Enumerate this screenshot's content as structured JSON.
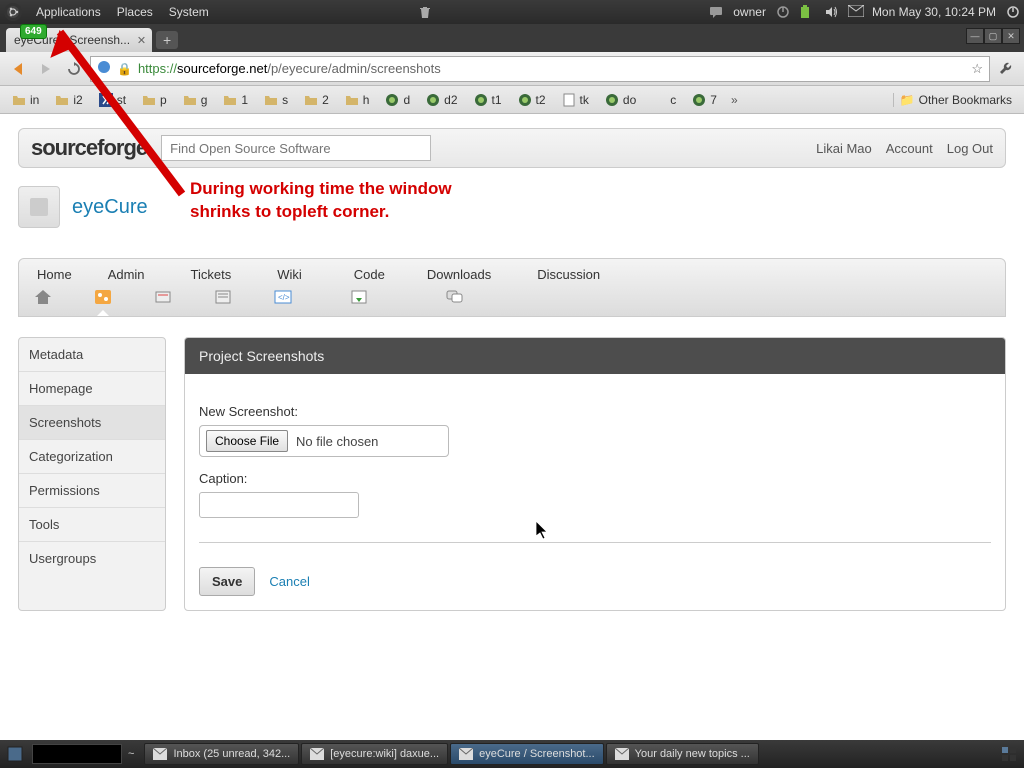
{
  "gnome": {
    "menus": [
      "Applications",
      "Places",
      "System"
    ],
    "owner": "owner",
    "clock": "Mon May 30, 10:24 PM"
  },
  "browser": {
    "tab_title": "eyeCure / Screensh...",
    "url_scheme": "https://",
    "url_host": "sourceforge.net",
    "url_path": "/p/eyecure/admin/screenshots",
    "bookmarks": [
      "in",
      "i2",
      "st",
      "p",
      "g",
      "1",
      "s",
      "2",
      "h",
      "d",
      "d2",
      "t1",
      "t2",
      "tk",
      "do",
      "c",
      "7"
    ],
    "other_bookmarks": "Other Bookmarks"
  },
  "sourceforge": {
    "logo": "sourceforge",
    "search_placeholder": "Find Open Source Software",
    "user": "Likai Mao",
    "account": "Account",
    "logout": "Log Out",
    "project_name": "eyeCure",
    "tabs": [
      "Home",
      "Admin",
      "Tickets",
      "Wiki",
      "Code",
      "Downloads",
      "Discussion"
    ],
    "sidebar": [
      "Metadata",
      "Homepage",
      "Screenshots",
      "Categorization",
      "Permissions",
      "Tools",
      "Usergroups"
    ],
    "sidebar_active_index": 2,
    "panel_title": "Project Screenshots",
    "new_screenshot_label": "New Screenshot:",
    "choose_file": "Choose File",
    "no_file": "No file chosen",
    "caption_label": "Caption:",
    "save": "Save",
    "cancel": "Cancel"
  },
  "annotation": {
    "badge": "649",
    "text": "During working time the window\nshrinks to topleft corner."
  },
  "taskbar": {
    "items": [
      "Inbox (25 unread, 342...",
      "[eyecure:wiki] daxue...",
      "eyeCure / Screenshot...",
      "Your daily new topics ..."
    ],
    "active_index": 2
  }
}
